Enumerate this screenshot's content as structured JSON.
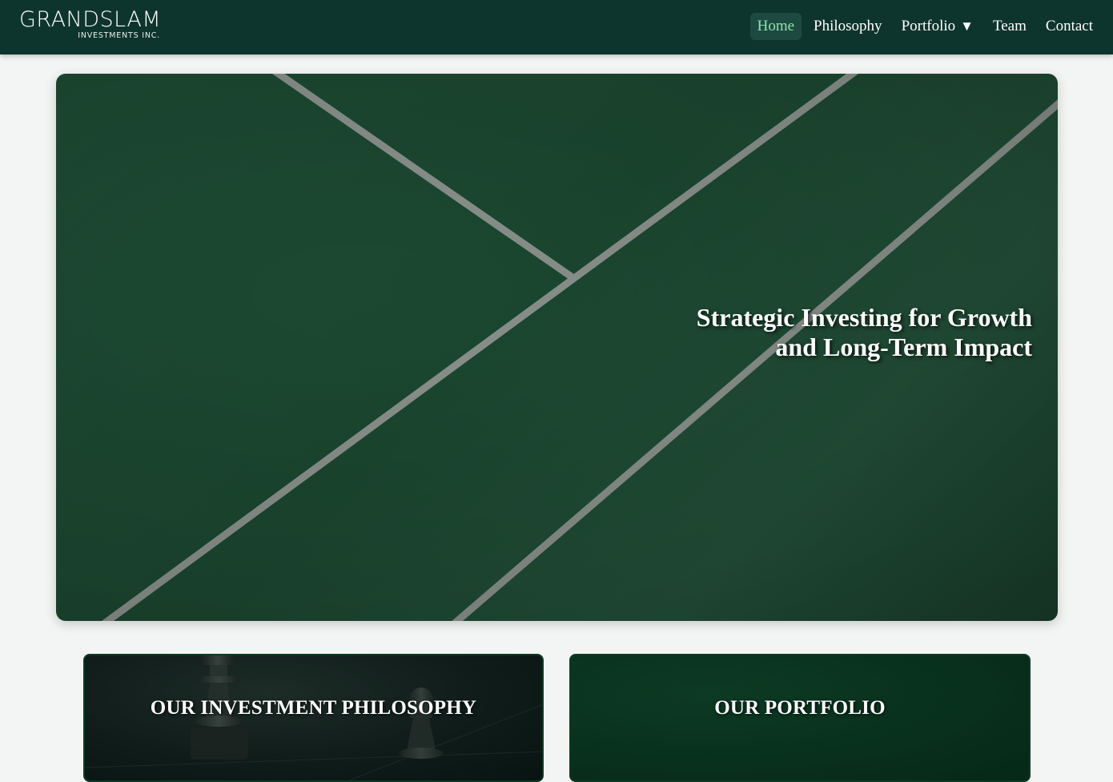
{
  "header": {
    "logo_main": "GRANDSLAM",
    "logo_sub": "INVESTMENTS INC.",
    "nav": [
      {
        "label": "Home",
        "active": true
      },
      {
        "label": "Philosophy",
        "active": false
      },
      {
        "label": "Portfolio",
        "active": false,
        "caret": "▼"
      },
      {
        "label": "Team",
        "active": false
      },
      {
        "label": "Contact",
        "active": false
      }
    ]
  },
  "hero": {
    "title": "Strategic Investing for Growth and Long-Term Impact"
  },
  "cards": {
    "philosophy_title": "OUR INVESTMENT PHILOSOPHY",
    "portfolio_title": "OUR PORTFOLIO"
  },
  "colors": {
    "header_bg": "#0e352d",
    "active_nav_text": "#8fe0b0",
    "hero_green": "#1d4a33",
    "page_bg": "#f3f5f4"
  }
}
